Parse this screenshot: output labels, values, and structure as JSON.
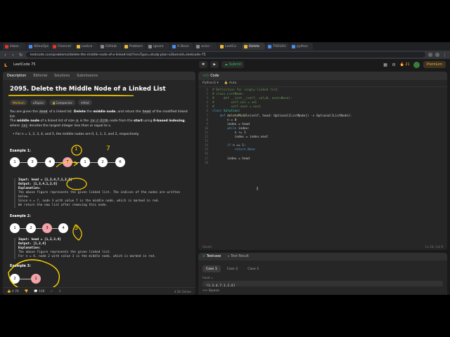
{
  "browser": {
    "tabs": [
      {
        "label": "Inbox -",
        "fav": "red"
      },
      {
        "label": "ADevOps",
        "fav": "blue"
      },
      {
        "label": "Channel",
        "fav": "red"
      },
      {
        "label": "Leetco",
        "fav": ""
      },
      {
        "label": "GitHub",
        "fav": "gray"
      },
      {
        "label": "Problem",
        "fav": ""
      },
      {
        "label": "ignore",
        "fav": "gray"
      },
      {
        "label": "A Devo",
        "fav": "blue"
      },
      {
        "label": "aniss -",
        "fav": "gray"
      },
      {
        "label": "LeetCo",
        "fav": ""
      },
      {
        "label": "Delete",
        "fav": "",
        "active": true
      },
      {
        "label": "THESAU",
        "fav": "blue"
      },
      {
        "label": "python",
        "fav": "blue"
      }
    ],
    "url": "leetcode.com/problems/delete-the-middle-node-of-a-linked-list/?envType=study-plan-v2&envId=leetcode-75"
  },
  "header": {
    "list_label": "LeetCode 75",
    "run_label": "▶",
    "submit_label": "Submit",
    "streak": "21",
    "premium_label": "Premium"
  },
  "left": {
    "tabs": [
      "Description",
      "Editorial",
      "Solutions",
      "Submissions"
    ],
    "title": "2095. Delete the Middle Node of a Linked List",
    "badges": [
      "Medium",
      "Topics",
      "Companies",
      "Hint"
    ],
    "para1_pre": "You are given the ",
    "para1_code1": "head",
    "para1_mid": " of a linked list. ",
    "para1_b1": "Delete",
    "para1_mid2": " the ",
    "para1_b2": "middle node",
    "para1_mid3": ", and return the ",
    "para1_code2": "head",
    "para1_post": " of the modified linked list.",
    "para2_pre": "The ",
    "para2_b1": "middle node",
    "para2_mid": " of a linked list of size ",
    "para2_code1": "n",
    "para2_mid2": " is the ",
    "para2_code2": "⌊n / 2⌋th",
    "para2_mid3": " node from the ",
    "para2_b2": "start",
    "para2_mid4": " using ",
    "para2_b3": "0-based indexing",
    "para2_mid5": ", where ",
    "para2_code3": "⌊x⌋",
    "para2_post": " denotes the largest integer less than or equal to x.",
    "bullet": "For n = 1, 2, 3, 4, and 5, the middle nodes are 0, 1, 1, 2, and 2, respectively.",
    "example1_label": "Example 1:",
    "example1_nodes": [
      "1",
      "3",
      "4",
      "7",
      "1",
      "2",
      "6"
    ],
    "example1_pre": [
      "Input: head = [1,3,4,7,1,2,6]",
      "Output: [1,3,4,1,2,6]",
      "Explanation:",
      "The above figure represents the given linked list. The indices of the nodes are written",
      "below.",
      "Since n = 7, node 3 with value 7 is the middle node, which is marked in red.",
      "We return the new list after removing this node."
    ],
    "example2_label": "Example 2:",
    "example2_nodes": [
      "1",
      "2",
      "3",
      "4"
    ],
    "example2_pre": [
      "Input: head = [1,2,3,4]",
      "Output: [1,2,4]",
      "Explanation:",
      "The above figure represents the given linked list.",
      "For n = 4, node 2 with value 3 is the middle node, which is marked in red."
    ],
    "example3_label": "Example 3:",
    "example3_nodes": [
      "2",
      "1"
    ],
    "annot_top1": "1",
    "annot_top2": "7",
    "annot_mid": "3",
    "footer_likes": "4.7K",
    "footer_comments": "108",
    "online": "4.5K Online"
  },
  "code": {
    "tab_label": "Code",
    "language": "Python3",
    "auto_label": "Auto",
    "lines": [
      [
        [
          "cm",
          "# Definition for singly-linked list."
        ]
      ],
      [
        [
          "cm",
          "# class ListNode:"
        ]
      ],
      [
        [
          "cm",
          "#     def __init__(self, val=0, next=None):"
        ]
      ],
      [
        [
          "cm",
          "#         self.val = val"
        ]
      ],
      [
        [
          "cm",
          "#         self.next = next"
        ]
      ],
      [
        [
          "kw",
          "class "
        ],
        [
          "ty",
          "Solution"
        ],
        [
          "tx",
          ":"
        ]
      ],
      [
        [
          "tx",
          "    "
        ],
        [
          "kw",
          "def "
        ],
        [
          "fn",
          "deleteMiddle"
        ],
        [
          "tx",
          "(self, head: Optional[ListNode]) -> Optional[ListNode]:"
        ]
      ],
      [
        [
          "tx",
          "        n = 0"
        ]
      ],
      [
        [
          "tx",
          "        index = head"
        ]
      ],
      [
        [
          "tx",
          "        "
        ],
        [
          "kw",
          "while "
        ],
        [
          "tx",
          "index:"
        ]
      ],
      [
        [
          "tx",
          "            n += 1"
        ]
      ],
      [
        [
          "tx",
          "            index = index.next"
        ]
      ],
      [
        [
          "tx",
          ""
        ]
      ],
      [
        [
          "tx",
          "        "
        ],
        [
          "kw",
          "if "
        ],
        [
          "tx",
          "n == 1:"
        ]
      ],
      [
        [
          "tx",
          "            "
        ],
        [
          "kw",
          "return "
        ],
        [
          "kw",
          "None"
        ]
      ],
      [
        [
          "tx",
          ""
        ]
      ],
      [
        [
          "tx",
          "        index = head"
        ]
      ],
      [
        [
          "tx",
          "        "
        ]
      ]
    ],
    "saved_label": "Saved",
    "position": "Ln 18, Col 9"
  },
  "test": {
    "tabs": [
      "Testcase",
      "Test Result"
    ],
    "cases": [
      "Case 1",
      "Case 2",
      "Case 3"
    ],
    "input_label": "head =",
    "input_value": "[1,3,4,7,1,2,6]",
    "footer_label": "Source"
  },
  "colors": {
    "accent_orange": "#f89f1b",
    "submit_green": "#2cbb5d",
    "annotation_yellow": "#ffd400",
    "highlight_red_node": "#f4a3a8"
  }
}
